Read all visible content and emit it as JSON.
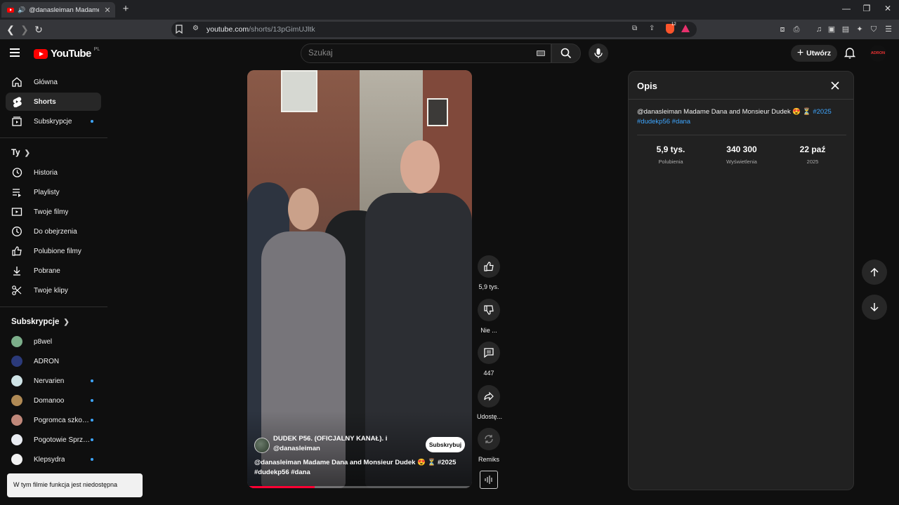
{
  "browser": {
    "tab_title": "@danasleiman Madame Dana",
    "url_host": "youtube.com",
    "url_path": "/shorts/13pGimUJltk",
    "brave_count": "12"
  },
  "header": {
    "logo_text": "YouTube",
    "logo_country": "PL",
    "search_placeholder": "Szukaj",
    "create_label": "Utwórz",
    "avatar_text": "ADRON"
  },
  "sidebar": {
    "main": [
      {
        "label": "Główna",
        "icon": "home-icon"
      },
      {
        "label": "Shorts",
        "icon": "shorts-icon"
      },
      {
        "label": "Subskrypcje",
        "icon": "subscriptions-icon"
      }
    ],
    "you_heading": "Ty",
    "you": [
      {
        "label": "Historia",
        "icon": "history-icon"
      },
      {
        "label": "Playlisty",
        "icon": "playlist-icon"
      },
      {
        "label": "Twoje filmy",
        "icon": "your-videos-icon"
      },
      {
        "label": "Do obejrzenia",
        "icon": "watch-later-icon"
      },
      {
        "label": "Polubione filmy",
        "icon": "liked-icon"
      },
      {
        "label": "Pobrane",
        "icon": "download-icon"
      },
      {
        "label": "Twoje klipy",
        "icon": "clips-icon"
      }
    ],
    "subs_heading": "Subskrypcje",
    "subs": [
      {
        "label": "p8wel",
        "color": "#7cae8a"
      },
      {
        "label": "ADRON",
        "color": "#2b3a7a"
      },
      {
        "label": "Nervarien",
        "color": "#cfe3e6"
      },
      {
        "label": "Domanoo",
        "color": "#b08a55"
      },
      {
        "label": "Pogromca szkodników",
        "color": "#c0887a"
      },
      {
        "label": "Pogotowie Sprzątanie",
        "color": "#e9ecf2"
      },
      {
        "label": "Klepsydra",
        "color": "#f2f2f2"
      }
    ]
  },
  "video": {
    "channel_name": "DUDEK P56. (OFICJALNY KANAŁ). i",
    "channel_sub": "@danasleiman",
    "subscribe_label": "Subskrybuj",
    "desc_line1": "@danasleiman Madame Dana and Monsieur Dudek 😍 ⏳ #2025",
    "desc_line2": "#dudekp56 #dana",
    "progress": 0.3
  },
  "actions": {
    "like": "5,9 tys.",
    "dislike": "Nie ...",
    "comments": "447",
    "share": "Udostę...",
    "remix": "Remiks"
  },
  "panel": {
    "title": "Opis",
    "desc_text": "@danasleiman Madame Dana and Monsieur Dudek 😍 ⏳",
    "tag1": "#2025",
    "tag2": "#dudekp56",
    "tag3": "#dana",
    "stats": [
      {
        "value": "5,9 tys.",
        "label": "Polubienia"
      },
      {
        "value": "340 300",
        "label": "Wyświetlenia"
      },
      {
        "value": "22 paź",
        "label": "2025"
      }
    ]
  },
  "toast": "W tym filmie funkcja jest niedostępna",
  "colors": {
    "accent": "#ff0000",
    "link": "#3ea6ff",
    "progress": "#ff0033"
  }
}
